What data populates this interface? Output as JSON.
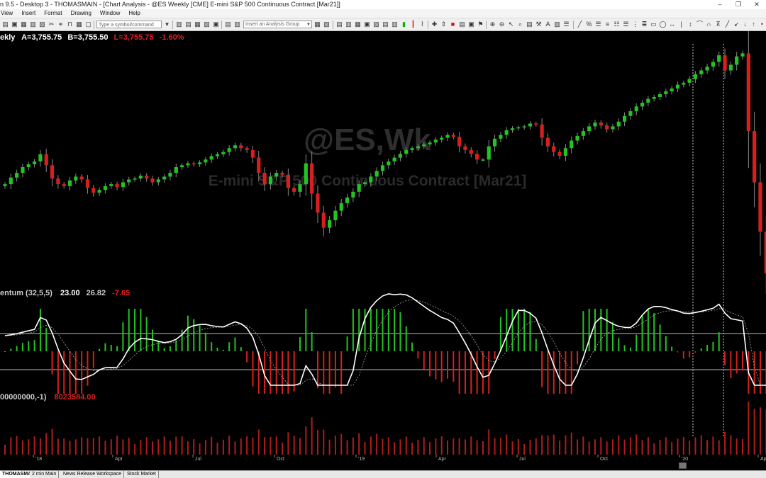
{
  "window": {
    "title": "n 9.5 - Desktop 3 - THOMASMAIN - [Chart Analysis - @ES Weekly [CME] E-mini S&P 500 Continuous Contract [Mar21]]",
    "controls": [
      "–",
      "❐",
      "✕"
    ]
  },
  "menu": [
    "View",
    "Insert",
    "Format",
    "Drawing",
    "Window",
    "Help"
  ],
  "toolbar": {
    "symbol_placeholder": "Type a symbol/command",
    "analysis_placeholder": "Insert an Analysis Group"
  },
  "chart": {
    "watermark_symbol": "@ES,Wk",
    "watermark_desc": "E-mini S&P 500 Continuous Contract [Mar21]",
    "price_header": {
      "label": "ekly",
      "a": "A=3,755.75",
      "b": "B=3,755.50",
      "l": "L=3,755.75",
      "change": "-1.60%"
    },
    "momentum_header": {
      "label": "entum (32,5,5)",
      "v1": "23.00",
      "v2": "26.82",
      "v3": "-7.65"
    },
    "volume_header": {
      "label": "00000000,-1)",
      "value": "8023584.00"
    },
    "x_labels": [
      "'18",
      "Apr",
      "Jul",
      "Oct",
      "'19",
      "Apr",
      "Jul",
      "Oct",
      "'20",
      "Apr"
    ],
    "colors": {
      "up": "#22c322",
      "down": "#d81f1f",
      "volume": "#b01c1c",
      "line": "#ffffff"
    }
  },
  "workspace_tabs": [
    "THOMASMAIN",
    "2 min Main",
    "News Release Workspace",
    "Stock Market"
  ],
  "chart_data": {
    "type": "table",
    "price_series": [
      2700,
      2735,
      2760,
      2790,
      2805,
      2820,
      2858,
      2800,
      2730,
      2700,
      2690,
      2720,
      2740,
      2725,
      2680,
      2655,
      2670,
      2690,
      2700,
      2685,
      2710,
      2725,
      2730,
      2745,
      2730,
      2710,
      2725,
      2740,
      2760,
      2790,
      2800,
      2810,
      2805,
      2815,
      2830,
      2848,
      2858,
      2870,
      2890,
      2905,
      2890,
      2880,
      2840,
      2760,
      2700,
      2740,
      2760,
      2750,
      2680,
      2660,
      2700,
      2810,
      2650,
      2550,
      2470,
      2510,
      2560,
      2600,
      2630,
      2660,
      2700,
      2710,
      2740,
      2770,
      2800,
      2820,
      2840,
      2860,
      2880,
      2890,
      2900,
      2910,
      2920,
      2935,
      2945,
      2960,
      2950,
      2900,
      2880,
      2860,
      2830,
      2830,
      2900,
      2940,
      2960,
      2985,
      2995,
      3000,
      3005,
      3020,
      3015,
      2945,
      2900,
      2870,
      2850,
      2890,
      2930,
      2955,
      2980,
      3005,
      3025,
      3010,
      2990,
      3005,
      3030,
      3060,
      3085,
      3110,
      3130,
      3150,
      3160,
      3175,
      3190,
      3205,
      3225,
      3235,
      3255,
      3280,
      3300,
      3320,
      3345,
      3380,
      3300,
      3330,
      3374,
      3390,
      2980,
      2710,
      2450,
      2230,
      2480,
      2640,
      2780
    ]
  }
}
